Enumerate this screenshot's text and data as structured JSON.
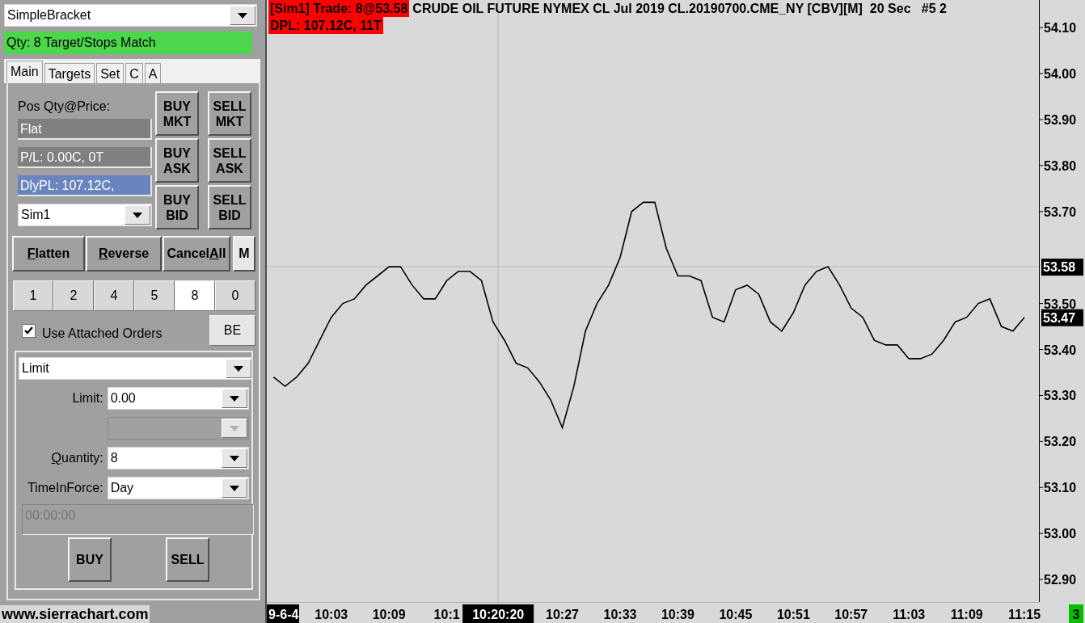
{
  "strategy_select": {
    "value": "SimpleBracket"
  },
  "status_message": {
    "text": "Qty: 8 Target/Stops Match"
  },
  "tabs": [
    {
      "label": "Main",
      "selected": true
    },
    {
      "label": "Targets",
      "selected": false
    },
    {
      "label": "Set",
      "selected": false
    },
    {
      "label": "C",
      "selected": false
    },
    {
      "label": "A",
      "selected": false
    }
  ],
  "position": {
    "label": "Pos Qty@Price:",
    "value": "Flat",
    "pl": "P/L: 0.00C, 0T",
    "daily_pl": "DlyPL: 107.12C,"
  },
  "account_select": {
    "value": "Sim1"
  },
  "order_buttons": [
    {
      "label": "BUY MKT"
    },
    {
      "label": "SELL MKT"
    },
    {
      "label": "BUY ASK"
    },
    {
      "label": "SELL ASK"
    },
    {
      "label": "BUY BID"
    },
    {
      "label": "SELL BID"
    }
  ],
  "action_buttons": [
    {
      "key": "F",
      "tail": "latten",
      "kind": "wide"
    },
    {
      "key": "R",
      "tail": "everse",
      "kind": "wide"
    },
    {
      "lead": "Cancel",
      "key": "A",
      "tail": "ll",
      "kind": "wide"
    },
    {
      "lead": "M",
      "kind": "small"
    }
  ],
  "quantity_buttons": [
    {
      "label": "1",
      "selected": false
    },
    {
      "label": "2",
      "selected": false
    },
    {
      "label": "4",
      "selected": false
    },
    {
      "label": "5",
      "selected": false
    },
    {
      "label": "8",
      "selected": true
    },
    {
      "label": "0",
      "selected": false
    }
  ],
  "use_attached_orders": {
    "label": "Use Attached Orders",
    "checked": true
  },
  "be_button": {
    "label": "BE"
  },
  "order_type": {
    "value": "Limit"
  },
  "fields": [
    {
      "lead": "Limit:",
      "value": "0.00",
      "disabled": false
    },
    {
      "disabled": true
    },
    {
      "key": "Q",
      "tail": "uantity:",
      "value": "8",
      "disabled": false
    },
    {
      "lead": "TimeInForce:",
      "value": "Day",
      "disabled": false
    }
  ],
  "time_field": {
    "placeholder": "00:00:00",
    "disabled": true
  },
  "submit_buttons": [
    {
      "label": "BUY"
    },
    {
      "label": "SELL"
    }
  ],
  "website": "www.sierrachart.com",
  "chart": {
    "header": {
      "trade": "[Sim1]  Trade: 8@53.58",
      "title": "CRUDE OIL FUTURE NYMEX CL Jul 2019 CL.20190700.CME_NY [CBV][M]  20 Sec   #5 2",
      "dpl": "DPL: 107.12C, 11T"
    },
    "cursor": {
      "price": "53.58",
      "time": "10:20:20"
    },
    "last_price": "53.47",
    "date_label": "9-6-4",
    "bar_count": "3",
    "chart_data": {
      "type": "line",
      "ylim": [
        52.851,
        54.16
      ],
      "categories": [
        null,
        null,
        null,
        null,
        null,
        "10:03",
        null,
        null,
        null,
        null,
        "10:09",
        null,
        null,
        null,
        null,
        "10:1",
        null,
        null,
        null,
        null,
        null,
        null,
        null,
        null,
        null,
        "10:27",
        null,
        null,
        null,
        null,
        "10:33",
        null,
        null,
        null,
        null,
        "10:39",
        null,
        null,
        null,
        null,
        "10:45",
        null,
        null,
        null,
        null,
        "10:51",
        null,
        null,
        null,
        null,
        "10:57",
        null,
        null,
        null,
        null,
        "11:03",
        null,
        null,
        null,
        null,
        "11:09",
        null,
        null,
        null,
        null,
        "11:15"
      ],
      "values": [
        53.34,
        53.32,
        53.34,
        53.37,
        53.42,
        53.47,
        53.5,
        53.51,
        53.54,
        53.56,
        53.58,
        53.58,
        53.54,
        53.51,
        53.51,
        53.55,
        53.57,
        53.57,
        53.55,
        53.46,
        53.42,
        53.37,
        53.36,
        53.33,
        53.29,
        53.23,
        53.32,
        53.44,
        53.5,
        53.54,
        53.6,
        53.7,
        53.72,
        53.72,
        53.62,
        53.56,
        53.56,
        53.55,
        53.47,
        53.46,
        53.53,
        53.54,
        53.52,
        53.46,
        53.44,
        53.48,
        53.54,
        53.57,
        53.58,
        53.54,
        53.49,
        53.47,
        53.42,
        53.41,
        53.41,
        53.38,
        53.38,
        53.39,
        53.42,
        53.46,
        53.47,
        53.5,
        53.51,
        53.45,
        53.44,
        53.47
      ],
      "yticks": [
        {
          "value": 54.1,
          "label": "54.10"
        },
        {
          "value": 54.0,
          "label": "54.00"
        },
        {
          "value": 53.9,
          "label": "53.90"
        },
        {
          "value": 53.8,
          "label": "53.80"
        },
        {
          "value": 53.7,
          "label": "53.70"
        },
        {
          "value": 53.5,
          "label": "53.50"
        },
        {
          "value": 53.4,
          "label": "53.40"
        },
        {
          "value": 53.3,
          "label": "53.30"
        },
        {
          "value": 53.2,
          "label": "53.20"
        },
        {
          "value": 53.1,
          "label": "53.10"
        },
        {
          "value": 53.0,
          "label": "53.00"
        },
        {
          "value": 52.9,
          "label": "52.90"
        }
      ]
    }
  }
}
